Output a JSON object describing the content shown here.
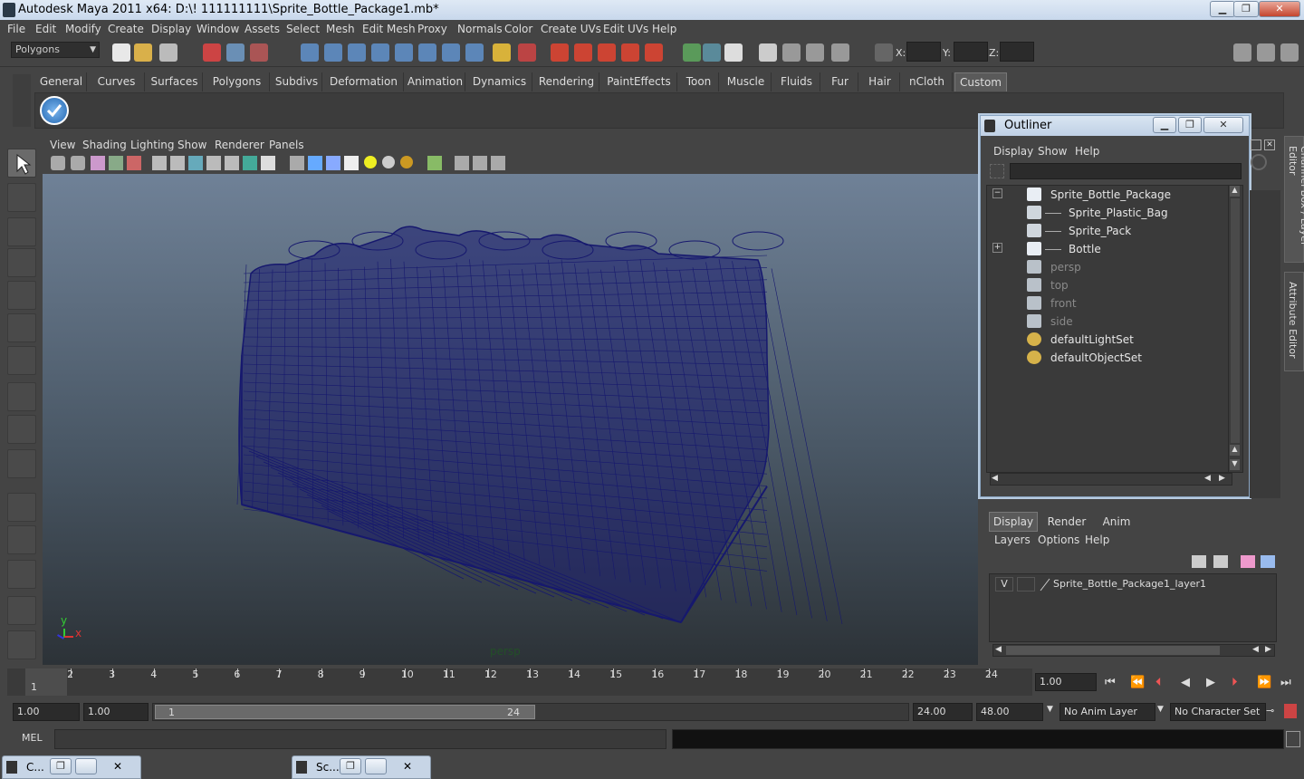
{
  "window": {
    "title": "Autodesk Maya 2011 x64: D:\\! 111111111\\Sprite_Bottle_Package1.mb*",
    "min": "▁",
    "max": "❐",
    "close": "✕"
  },
  "menubar": [
    "File",
    "Edit",
    "Modify",
    "Create",
    "Display",
    "Window",
    "Assets",
    "Select",
    "Mesh",
    "Edit Mesh",
    "Proxy",
    "Normals",
    "Color",
    "Create UVs",
    "Edit UVs",
    "Help"
  ],
  "statusline": {
    "mode": "Polygons",
    "x_label": "X:",
    "y_label": "Y:",
    "z_label": "Z:"
  },
  "shelf_tabs": [
    "General",
    "Curves",
    "Surfaces",
    "Polygons",
    "Subdivs",
    "Deformation",
    "Animation",
    "Dynamics",
    "Rendering",
    "PaintEffects",
    "Toon",
    "Muscle",
    "Fluids",
    "Fur",
    "Hair",
    "nCloth",
    "Custom"
  ],
  "shelf_active": "Custom",
  "viewport": {
    "menu": [
      "View",
      "Shading",
      "Lighting",
      "Show",
      "Renderer",
      "Panels"
    ],
    "camera_label": "persp",
    "axis_y": "y",
    "axis_x": "x",
    "wire_color": "#16186e"
  },
  "outliner": {
    "title": "Outliner",
    "menu": [
      "Display",
      "Show",
      "Help"
    ],
    "items": [
      {
        "label": "Sprite_Bottle_Package",
        "indent": 0,
        "expand": "−",
        "dim": false,
        "kind": "transform"
      },
      {
        "label": "Sprite_Plastic_Bag",
        "indent": 1,
        "expand": "",
        "dim": false,
        "kind": "mesh"
      },
      {
        "label": "Sprite_Pack",
        "indent": 1,
        "expand": "",
        "dim": false,
        "kind": "mesh"
      },
      {
        "label": "Bottle",
        "indent": 1,
        "expand": "+",
        "dim": false,
        "kind": "transform"
      },
      {
        "label": "persp",
        "indent": 0,
        "expand": "",
        "dim": true,
        "kind": "camera"
      },
      {
        "label": "top",
        "indent": 0,
        "expand": "",
        "dim": true,
        "kind": "camera"
      },
      {
        "label": "front",
        "indent": 0,
        "expand": "",
        "dim": true,
        "kind": "camera"
      },
      {
        "label": "side",
        "indent": 0,
        "expand": "",
        "dim": true,
        "kind": "camera"
      },
      {
        "label": "defaultLightSet",
        "indent": 0,
        "expand": "",
        "dim": false,
        "kind": "set"
      },
      {
        "label": "defaultObjectSet",
        "indent": 0,
        "expand": "",
        "dim": false,
        "kind": "set"
      }
    ]
  },
  "side_tabs": {
    "channel": "Channel Box / Layer Editor",
    "attribute": "Attribute Editor"
  },
  "layers": {
    "tabs": [
      "Display",
      "Render",
      "Anim"
    ],
    "active_tab": "Display",
    "menu": [
      "Layers",
      "Options",
      "Help"
    ],
    "rows": [
      {
        "visible": "V",
        "name": "Sprite_Bottle_Package1_layer1"
      }
    ]
  },
  "timeline": {
    "ticks": [
      "1",
      "2",
      "3",
      "4",
      "5",
      "6",
      "7",
      "8",
      "9",
      "10",
      "11",
      "12",
      "13",
      "14",
      "15",
      "16",
      "17",
      "18",
      "19",
      "20",
      "21",
      "22",
      "23",
      "24"
    ],
    "current": "1",
    "current_time": "1.00"
  },
  "range": {
    "start": "1.00",
    "start2": "1.00",
    "slider_start": "1",
    "slider_end": "24",
    "end": "24.00",
    "end2": "48.00",
    "anim_layer": "No Anim Layer",
    "char_set": "No Character Set"
  },
  "cmdline": {
    "label": "MEL"
  },
  "taskbar": [
    {
      "label": "C..."
    },
    {
      "label": "Sc..."
    }
  ]
}
